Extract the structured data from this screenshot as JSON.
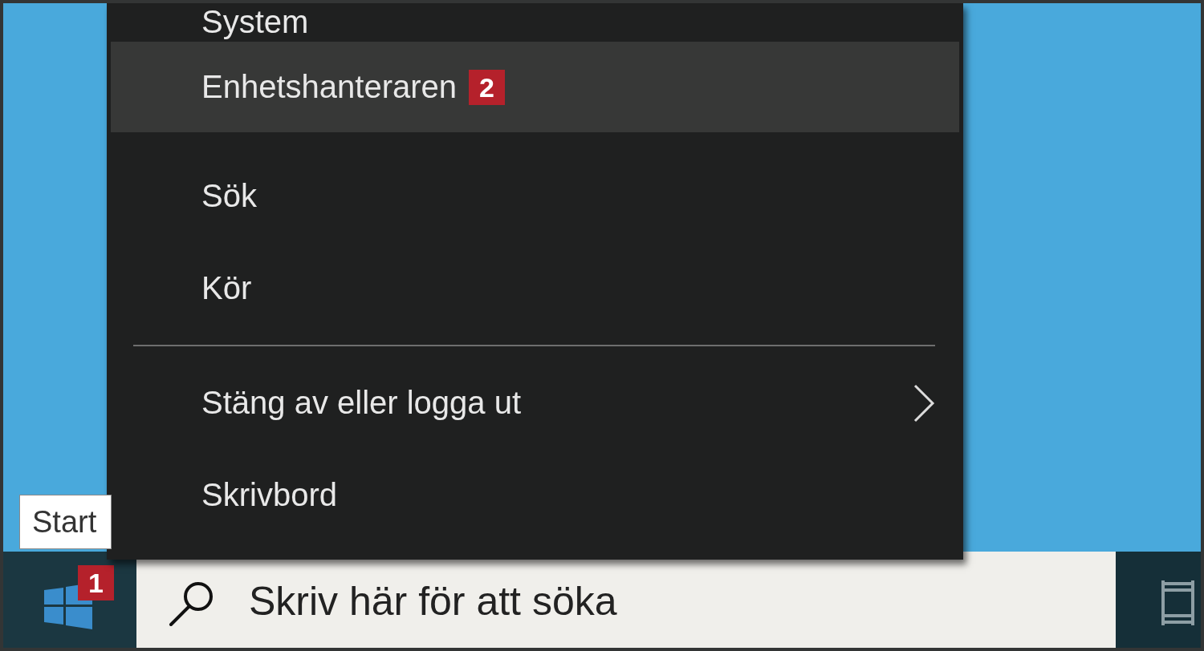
{
  "context_menu": {
    "items": [
      {
        "kind": "item",
        "label": "System",
        "selected": false,
        "submenu": false
      },
      {
        "kind": "item",
        "label": "Enhetshanteraren",
        "selected": true,
        "submenu": false,
        "callout": "2"
      },
      {
        "kind": "item",
        "label": "Sök",
        "selected": false,
        "submenu": false
      },
      {
        "kind": "item",
        "label": "Kör",
        "selected": false,
        "submenu": false
      },
      {
        "kind": "divider"
      },
      {
        "kind": "item",
        "label": "Stäng av eller logga ut",
        "selected": false,
        "submenu": true
      },
      {
        "kind": "item",
        "label": "Skrivbord",
        "selected": false,
        "submenu": false
      }
    ]
  },
  "tooltip": {
    "text": "Start"
  },
  "taskbar": {
    "start_button": {
      "callout": "1"
    },
    "search": {
      "placeholder": "Skriv här för att söka"
    }
  }
}
